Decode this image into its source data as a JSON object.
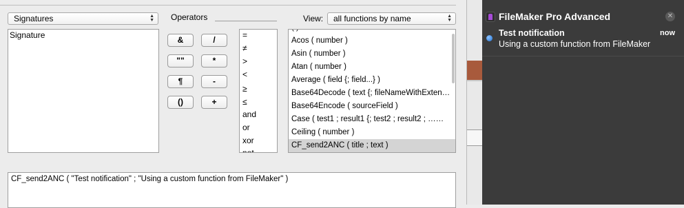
{
  "signatures_select": {
    "value": "Signatures"
  },
  "signature_panel": {
    "text": "Signature"
  },
  "operators": {
    "label": "Operators",
    "buttons": [
      "&",
      "/",
      "\"\"",
      "*",
      "¶",
      "-",
      "()",
      "+"
    ],
    "list": [
      "=",
      "≠",
      ">",
      "<",
      "≥",
      "≤",
      "and",
      "or",
      "xor",
      "not"
    ]
  },
  "view": {
    "label": "View:",
    "value": "all functions by name"
  },
  "functions": [
    "Acos ( number )",
    "Asin ( number )",
    "Atan ( number )",
    "Average ( field {; field...} )",
    "Base64Decode ( text {; fileNameWithExten…",
    "Base64Encode ( sourceField )",
    "Case ( test1 ; result1 {; test2 ; result2 ; ……",
    "Ceiling ( number )",
    "CF_send2ANC ( title ; text )"
  ],
  "selected_function_index": 8,
  "formula": {
    "text": "CF_send2ANC ( \"Test notification\" ; \"Using a custom function from FileMaker\" )"
  },
  "notification_center": {
    "app_name": "FileMaker Pro Advanced",
    "notification": {
      "title": "Test notification",
      "time": "now",
      "body": "Using a custom function from FileMaker"
    }
  },
  "colors": {
    "nc_background": "#3b3b3b",
    "notif_dot": "#2f86ea",
    "selected_row": "#d4d4d4"
  }
}
